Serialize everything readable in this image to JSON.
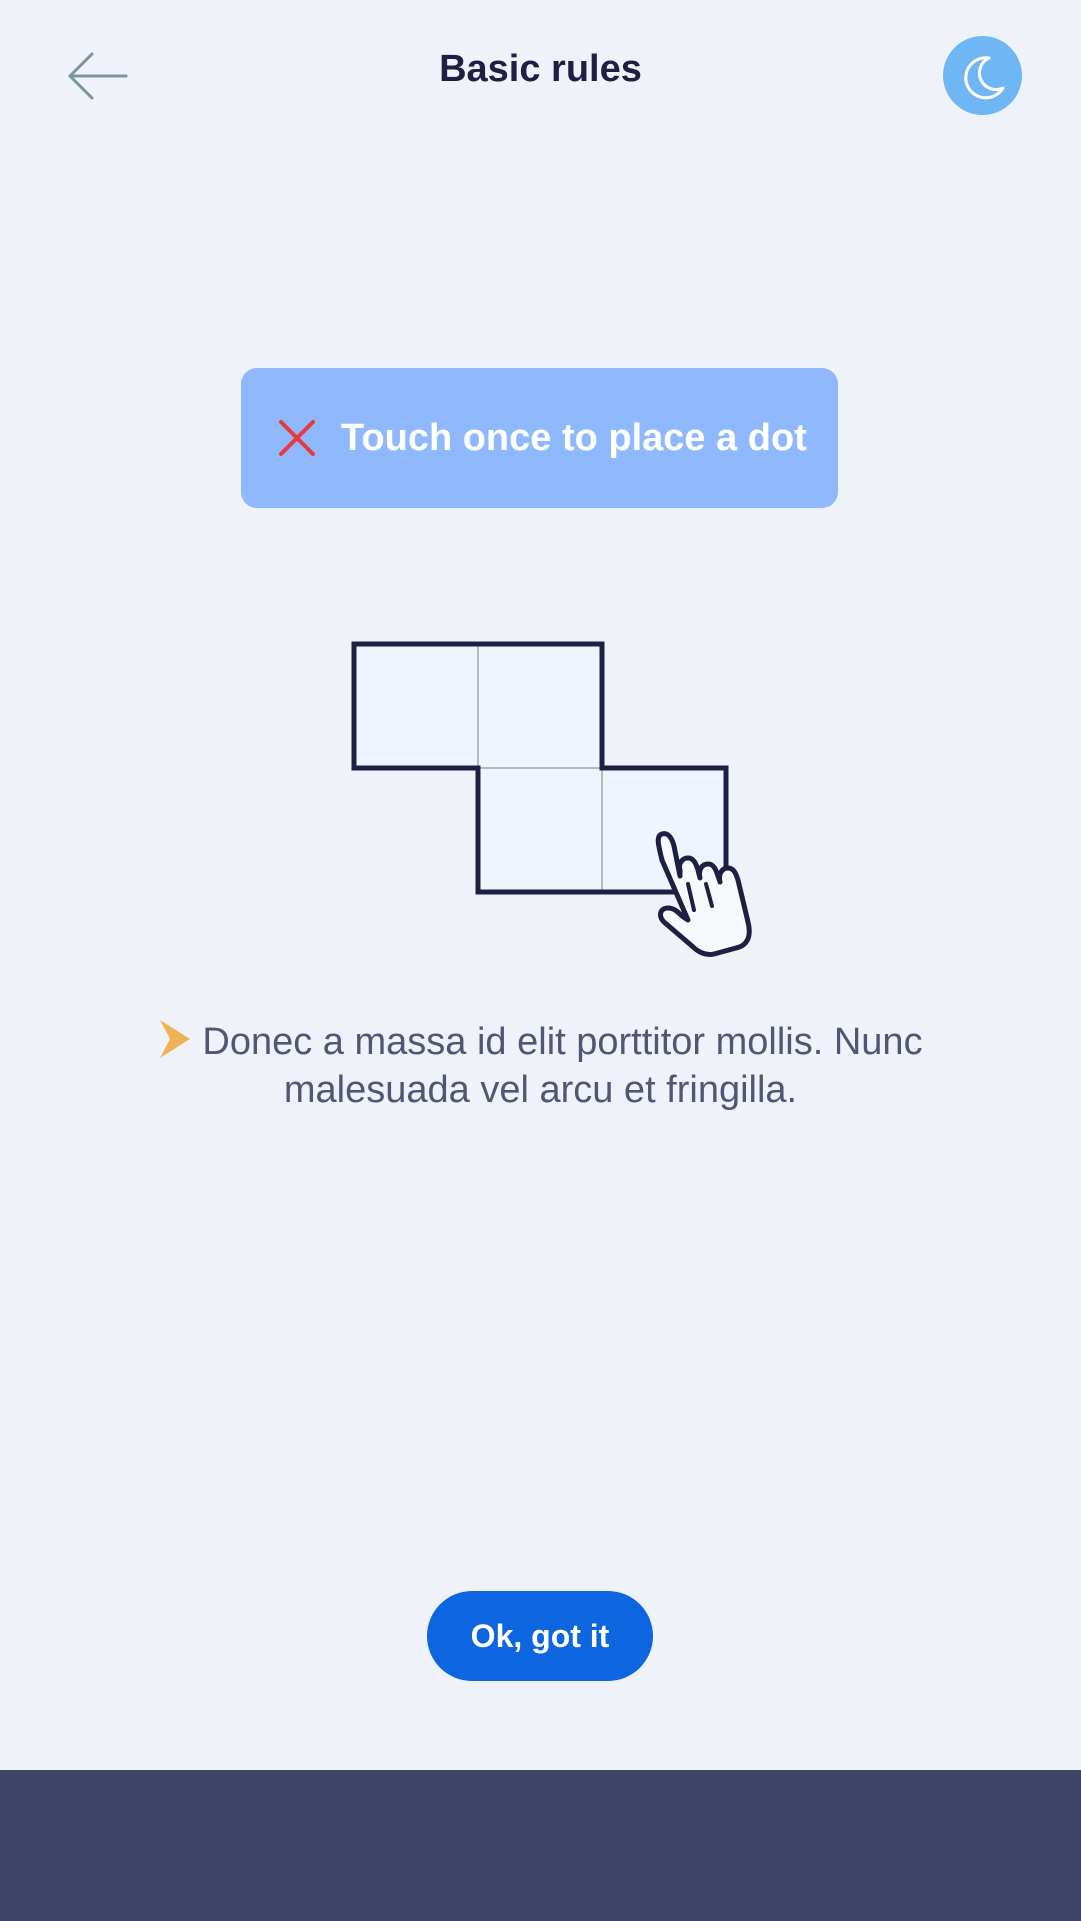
{
  "header": {
    "title": "Basic rules",
    "back_icon": "arrow-left-icon",
    "night_mode_icon": "moon-icon"
  },
  "hint": {
    "icon": "close-icon",
    "text": "Touch once to place a dot",
    "icon_color": "#e8383d",
    "background": "#8fb8fd"
  },
  "illustration": {
    "grid_icon": "polyomino-grid",
    "hand_icon": "tap-hand-icon"
  },
  "description": {
    "bullet_icon": "arrow-bullet-icon",
    "text": "Donec a massa id elit porttitor mollis. Nunc malesuada vel arcu et fringilla."
  },
  "actions": {
    "ok_label": "Ok, got it"
  },
  "colors": {
    "background": "#eff3f9",
    "primary": "#0d66df",
    "accent_blue": "#6fb6f5",
    "bottom_bar": "#404567",
    "title": "#1f1f44",
    "bullet": "#f0b256"
  }
}
